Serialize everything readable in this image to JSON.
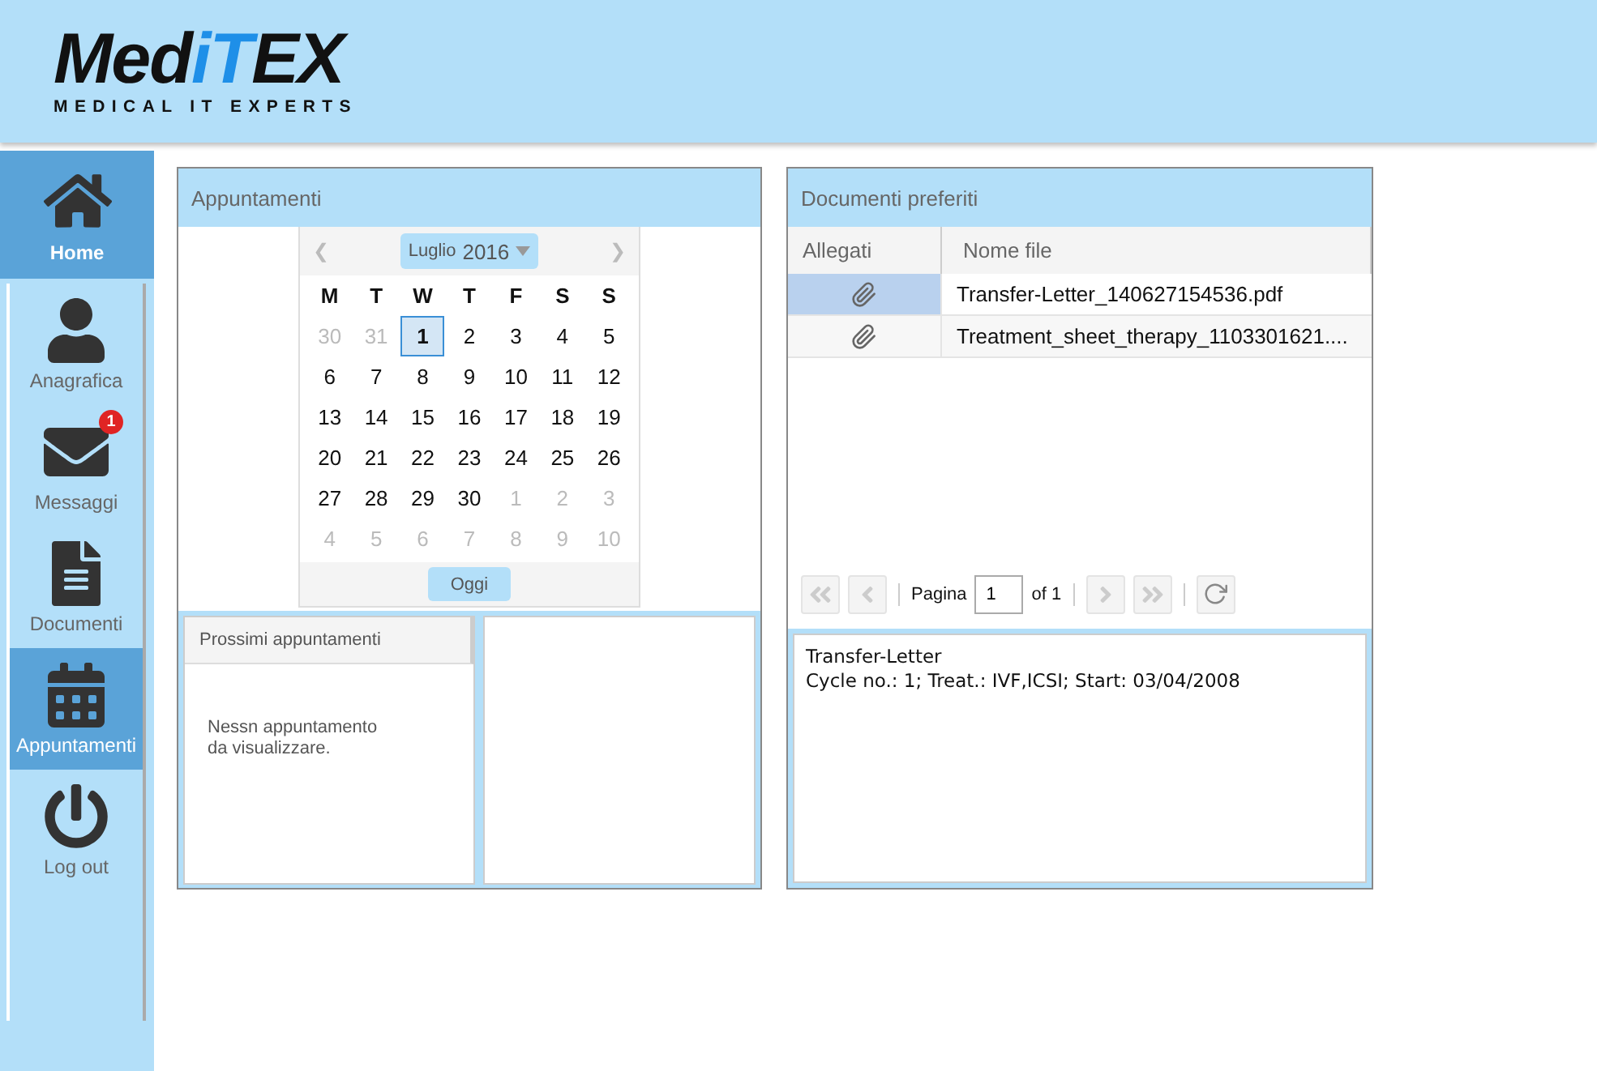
{
  "header": {
    "logo": {
      "parts": [
        {
          "text": "Med",
          "kind": "dark"
        },
        {
          "text": "iT",
          "kind": "accent"
        },
        {
          "text": "EX",
          "kind": "dark"
        }
      ],
      "tagline": "MEDICAL IT EXPERTS"
    }
  },
  "sidebar": {
    "home": {
      "label": "Home",
      "selected": true
    },
    "items": [
      {
        "kind": "person",
        "label": "Anagrafica",
        "selected": false
      },
      {
        "kind": "mail",
        "label": "Messaggi",
        "selected": false,
        "badge": "1"
      },
      {
        "kind": "document",
        "label": "Documenti",
        "selected": false
      },
      {
        "kind": "calendar",
        "label": "Appuntamenti",
        "selected": true
      },
      {
        "kind": "power",
        "label": "Log out",
        "selected": false
      }
    ]
  },
  "appointments": {
    "title": "Appuntamenti",
    "calendar": {
      "prev": "❮",
      "next": "❯",
      "month": "Luglio",
      "year": "2016",
      "weekdays": [
        "M",
        "T",
        "W",
        "T",
        "F",
        "S",
        "S"
      ],
      "weeks": [
        [
          {
            "day": "30",
            "muted": true,
            "selected": false
          },
          {
            "day": "31",
            "muted": true,
            "selected": false
          },
          {
            "day": "1",
            "muted": false,
            "selected": true
          },
          {
            "day": "2",
            "muted": false,
            "selected": false
          },
          {
            "day": "3",
            "muted": false,
            "selected": false
          },
          {
            "day": "4",
            "muted": false,
            "selected": false
          },
          {
            "day": "5",
            "muted": false,
            "selected": false
          }
        ],
        [
          {
            "day": "6",
            "muted": false,
            "selected": false
          },
          {
            "day": "7",
            "muted": false,
            "selected": false
          },
          {
            "day": "8",
            "muted": false,
            "selected": false
          },
          {
            "day": "9",
            "muted": false,
            "selected": false
          },
          {
            "day": "10",
            "muted": false,
            "selected": false
          },
          {
            "day": "11",
            "muted": false,
            "selected": false
          },
          {
            "day": "12",
            "muted": false,
            "selected": false
          }
        ],
        [
          {
            "day": "13",
            "muted": false,
            "selected": false
          },
          {
            "day": "14",
            "muted": false,
            "selected": false
          },
          {
            "day": "15",
            "muted": false,
            "selected": false
          },
          {
            "day": "16",
            "muted": false,
            "selected": false
          },
          {
            "day": "17",
            "muted": false,
            "selected": false
          },
          {
            "day": "18",
            "muted": false,
            "selected": false
          },
          {
            "day": "19",
            "muted": false,
            "selected": false
          }
        ],
        [
          {
            "day": "20",
            "muted": false,
            "selected": false
          },
          {
            "day": "21",
            "muted": false,
            "selected": false
          },
          {
            "day": "22",
            "muted": false,
            "selected": false
          },
          {
            "day": "23",
            "muted": false,
            "selected": false
          },
          {
            "day": "24",
            "muted": false,
            "selected": false
          },
          {
            "day": "25",
            "muted": false,
            "selected": false
          },
          {
            "day": "26",
            "muted": false,
            "selected": false
          }
        ],
        [
          {
            "day": "27",
            "muted": false,
            "selected": false
          },
          {
            "day": "28",
            "muted": false,
            "selected": false
          },
          {
            "day": "29",
            "muted": false,
            "selected": false
          },
          {
            "day": "30",
            "muted": false,
            "selected": false
          },
          {
            "day": "1",
            "muted": true,
            "selected": false
          },
          {
            "day": "2",
            "muted": true,
            "selected": false
          },
          {
            "day": "3",
            "muted": true,
            "selected": false
          }
        ],
        [
          {
            "day": "4",
            "muted": true,
            "selected": false
          },
          {
            "day": "5",
            "muted": true,
            "selected": false
          },
          {
            "day": "6",
            "muted": true,
            "selected": false
          },
          {
            "day": "7",
            "muted": true,
            "selected": false
          },
          {
            "day": "8",
            "muted": true,
            "selected": false
          },
          {
            "day": "9",
            "muted": true,
            "selected": false
          },
          {
            "day": "10",
            "muted": true,
            "selected": false
          }
        ]
      ],
      "today_button": "Oggi"
    },
    "upcoming": {
      "title": "Prossimi appuntamenti",
      "empty_line_1": "Nessn appuntamento",
      "empty_line_2": "da visualizzare."
    }
  },
  "documents": {
    "title": "Documenti preferiti",
    "columns": [
      "Allegati",
      "Nome file"
    ],
    "rows": [
      {
        "file": "Transfer-Letter_140627154536.pdf",
        "selected": true
      },
      {
        "file": "Treatment_sheet_therapy_1103301621....",
        "selected": false
      }
    ],
    "pager": {
      "page_label": "Pagina",
      "page": "1",
      "of": "of 1"
    },
    "preview": {
      "line_1": "Transfer-Letter",
      "line_2": "Cycle no.: 1; Treat.: IVF,ICSI; Start: 03/04/2008"
    }
  }
}
